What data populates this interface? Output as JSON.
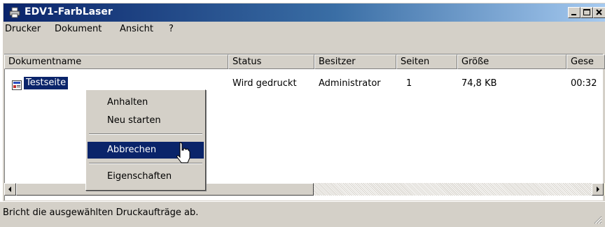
{
  "window": {
    "title": "EDV1-FarbLaser",
    "icon": "printer-icon",
    "controls": [
      "minimize-icon",
      "maximize-icon",
      "close-icon"
    ]
  },
  "menubar": {
    "items": [
      {
        "label": "Drucker"
      },
      {
        "label": "Dokument"
      },
      {
        "label": "Ansicht"
      },
      {
        "label": "?"
      }
    ]
  },
  "columns": [
    "Dokumentname",
    "Status",
    "Besitzer",
    "Seiten",
    "Größe",
    "Gese"
  ],
  "jobs": [
    {
      "name": "Testseite",
      "status": "Wird gedruckt",
      "owner": "Administrator",
      "pages": "1",
      "size": "74,8 KB",
      "submitted": "00:32"
    }
  ],
  "context_menu": {
    "items": [
      {
        "label": "Anhalten",
        "selected": false
      },
      {
        "label": "Neu starten",
        "selected": false
      },
      {
        "label": "Abbrechen",
        "selected": true
      },
      {
        "label": "Eigenschaften",
        "selected": false
      }
    ]
  },
  "statusbar": {
    "text": "Bricht die ausgewählten Druckaufträge ab."
  },
  "colors": {
    "selection": "#0a246a",
    "titlebar_start": "#0a246a",
    "titlebar_end": "#a6caf0",
    "face": "#d4d0c8"
  }
}
